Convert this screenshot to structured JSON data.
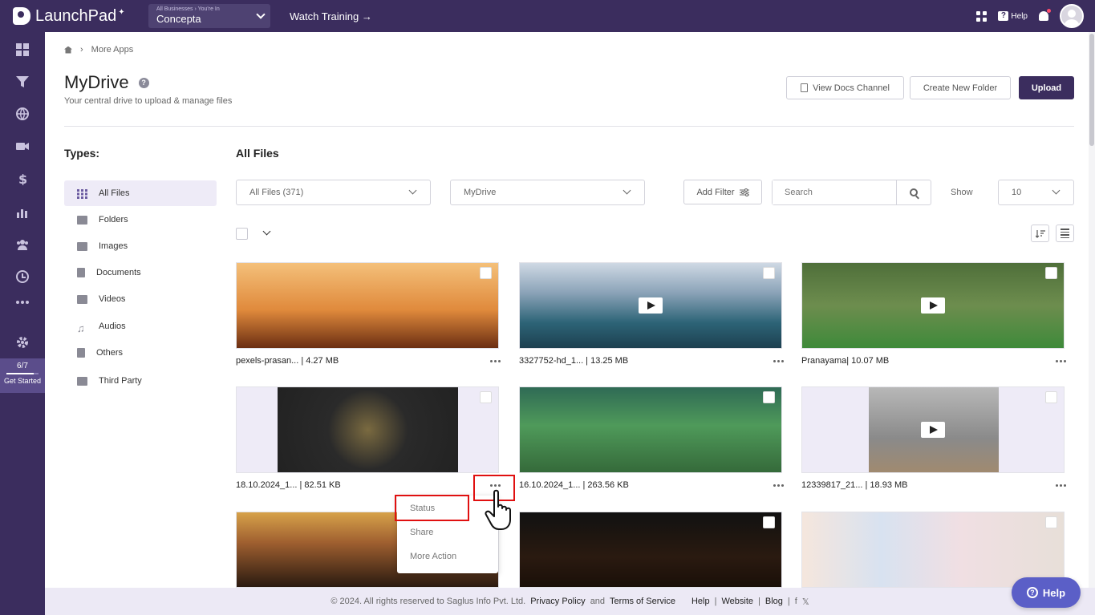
{
  "app": {
    "name": "LaunchPad",
    "business_switch_label": "All Businesses › You're In",
    "business_name": "Concepta",
    "watch_training": "Watch Training →",
    "help_label": "Help"
  },
  "rail": {
    "icons": [
      "dashboard-icon",
      "funnel-icon",
      "globe-icon",
      "video-icon",
      "dollar-icon",
      "analytics-icon",
      "team-icon",
      "report-icon",
      "more-icon",
      "settings-icon"
    ],
    "progress_text": "6/7",
    "progress_fraction": 0.857,
    "get_started": "Get Started"
  },
  "breadcrumb": {
    "current": "More Apps"
  },
  "page": {
    "title": "MyDrive",
    "subtitle": "Your central drive to upload & manage files",
    "buttons": {
      "view_docs": "View Docs Channel",
      "create_folder": "Create New Folder",
      "upload": "Upload"
    }
  },
  "types": {
    "title": "Types:",
    "items": [
      {
        "label": "All Files",
        "icon": "grid-icon",
        "active": true
      },
      {
        "label": "Folders",
        "icon": "folder-icon"
      },
      {
        "label": "Images",
        "icon": "image-icon"
      },
      {
        "label": "Documents",
        "icon": "document-icon"
      },
      {
        "label": "Videos",
        "icon": "video-icon"
      },
      {
        "label": "Audios",
        "icon": "music-icon"
      },
      {
        "label": "Others",
        "icon": "file-icon"
      },
      {
        "label": "Third Party",
        "icon": "third-party-icon"
      }
    ]
  },
  "files": {
    "title": "All Files",
    "filter_select": "All Files (371)",
    "location_select": "MyDrive",
    "add_filter": "Add Filter",
    "search_placeholder": "Search",
    "show_label": "Show",
    "show_value": "10",
    "items": [
      {
        "name": "pexels-prasan... | 4.27 MB",
        "video": false
      },
      {
        "name": "3327752-hd_1... | 13.25 MB",
        "video": true
      },
      {
        "name": "Pranayama| 10.07 MB",
        "video": true
      },
      {
        "name": "18.10.2024_1... | 82.51 KB",
        "video": false
      },
      {
        "name": "16.10.2024_1... | 263.56 KB",
        "video": false
      },
      {
        "name": "12339817_21... | 18.93 MB",
        "video": true
      },
      {
        "name": "",
        "video": false
      },
      {
        "name": "",
        "video": false
      },
      {
        "name": "",
        "video": false
      }
    ]
  },
  "context_menu": {
    "items": [
      "Status",
      "Share",
      "More Action"
    ]
  },
  "footer": {
    "copyright": "© 2024. All rights reserved to Saglus Info Pvt. Ltd.",
    "privacy": "Privacy Policy",
    "and": "and",
    "terms": "Terms of Service",
    "links": [
      "Help",
      "Website",
      "Blog"
    ]
  },
  "colors": {
    "brand": "#3b2d5e",
    "highlight": "#e01010",
    "help_button": "#5b5fc7"
  }
}
